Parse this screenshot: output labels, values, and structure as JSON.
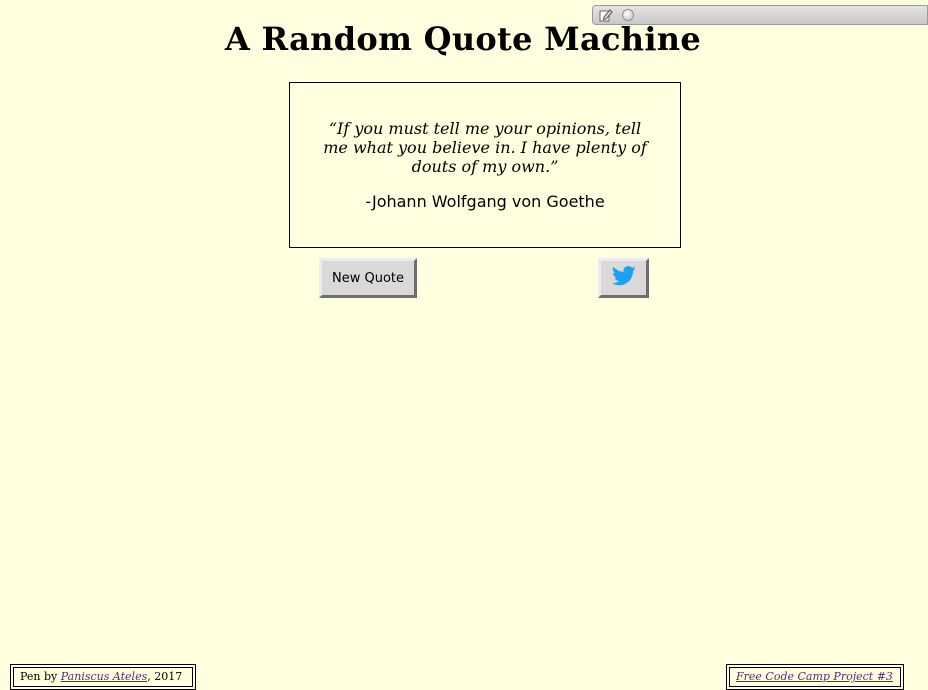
{
  "page": {
    "title": "A Random Quote Machine"
  },
  "quote": {
    "text": "“If you must tell me your opinions, tell me what you believe in. I have plenty of douts of my own.”",
    "author": "-Johann Wolfgang von Goethe"
  },
  "buttons": {
    "new_quote_label": "New Quote",
    "tweet_icon": "twitter-bird-icon"
  },
  "footer": {
    "left_prefix": "Pen by ",
    "author_link": "Paniscus Ateles",
    "left_suffix": ", 2017",
    "right_link": "Free Code Camp Project #3"
  },
  "overlay_toolbar": {
    "icons": [
      "edit-icon",
      "circle-icon"
    ]
  },
  "colors": {
    "background": "#ffffdf",
    "twitter_blue": "#1da1f2",
    "link": "#5a2a7a",
    "button_face": "#d9d9d9"
  }
}
